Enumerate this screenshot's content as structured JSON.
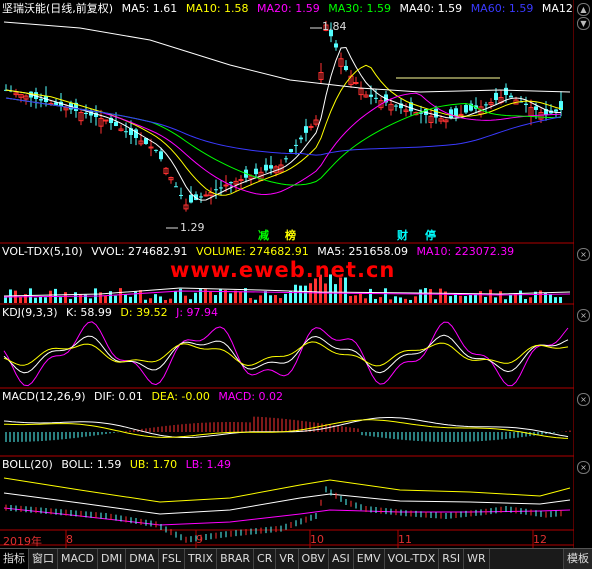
{
  "price_pane": {
    "stock_name": "坚瑞沃能(日线,前复权)",
    "ma5": "MA5: 1.61",
    "ma10": "MA10: 1.58",
    "ma20": "MA20: 1.59",
    "ma30": "MA30: 1.59",
    "ma40": "MA40: 1.59",
    "ma60": "MA60: 1.59",
    "ma120": "MA12",
    "high_label": "1.84",
    "low_label": "1.29",
    "events": [
      "减",
      "榜",
      "财",
      "停"
    ],
    "colors": {
      "ma5": "#ffffff",
      "ma10": "#ffff00",
      "ma20": "#ff00ff",
      "ma30": "#00ff00",
      "ma40": "#ffffff",
      "ma60": "#0000ff",
      "ma120": "#ffffff",
      "up": "#ff3232",
      "down": "#54ffff"
    }
  },
  "vol_pane": {
    "name": "VOL-TDX(5,10)",
    "vvol": "VVOL: 274682.91",
    "volume": "VOLUME: 274682.91",
    "ma5": "MA5: 251658.09",
    "ma10": "MA10: 223072.39"
  },
  "kdj_pane": {
    "name": "KDJ(9,3,3)",
    "k": "K: 58.99",
    "d": "D: 39.52",
    "j": "J: 97.94"
  },
  "macd_pane": {
    "name": "MACD(12,26,9)",
    "dif": "DIF: 0.01",
    "dea": "DEA: -0.00",
    "macd": "MACD: 0.02"
  },
  "boll_pane": {
    "name": "BOLL(20)",
    "boll": "BOLL: 1.59",
    "ub": "UB: 1.70",
    "lb": "LB: 1.49"
  },
  "date_axis": {
    "year": "2019年",
    "months": [
      "8",
      "9",
      "10",
      "11",
      "12"
    ]
  },
  "watermark": "www.eweb.net.cn",
  "tabs": [
    "指标",
    "窗口",
    "MACD",
    "DMI",
    "DMA",
    "FSL",
    "TRIX",
    "BRAR",
    "CR",
    "VR",
    "OBV",
    "ASI",
    "EMV",
    "VOL-TDX",
    "RSI",
    "WR",
    "模板"
  ],
  "controls": {
    "up": "▲",
    "down": "▼",
    "close": "×"
  }
}
